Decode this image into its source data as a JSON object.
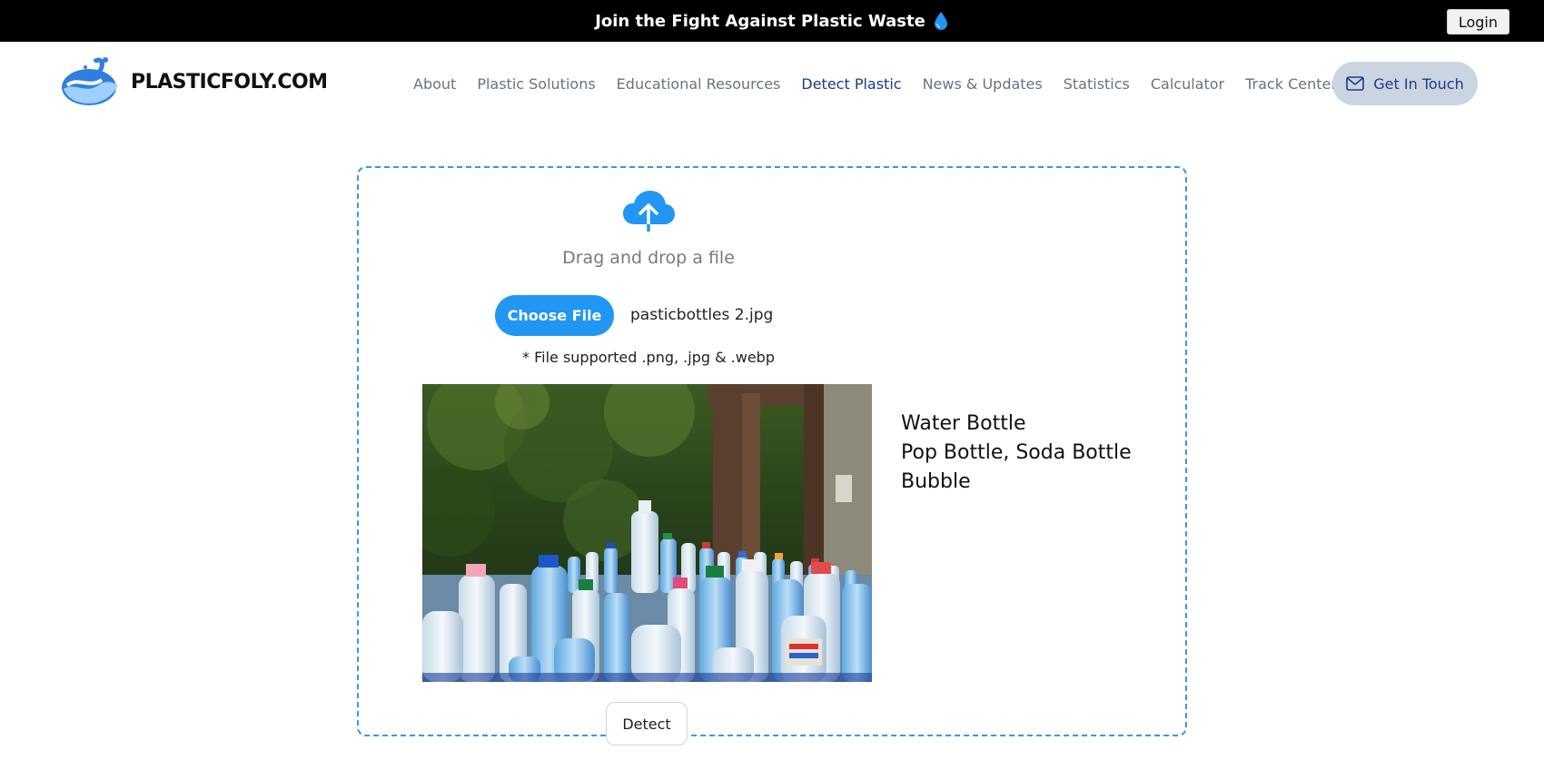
{
  "topbar": {
    "message": "Join the Fight Against Plastic Waste",
    "icon": "water-drop-icon",
    "login_label": "Login"
  },
  "header": {
    "logo_text": "PLASTICFOLY.COM",
    "nav": [
      {
        "label": "About",
        "active": false
      },
      {
        "label": "Plastic Solutions",
        "active": false
      },
      {
        "label": "Educational Resources",
        "active": false
      },
      {
        "label": "Detect Plastic",
        "active": true
      },
      {
        "label": "News & Updates",
        "active": false
      },
      {
        "label": "Statistics",
        "active": false
      },
      {
        "label": "Calculator",
        "active": false
      },
      {
        "label": "Track Centers",
        "active": false
      }
    ],
    "contact_label": "Get In Touch",
    "contact_icon": "mail-icon"
  },
  "upload": {
    "icon": "cloud-upload-icon",
    "drag_text": "Drag and drop a file",
    "choose_label": "Choose File",
    "file_name": "pasticbottles 2.jpg",
    "supported_text": "* File supported .png, .jpg & .webp",
    "results": [
      "Water Bottle",
      "Pop Bottle, Soda Bottle",
      "Bubble"
    ],
    "detect_label": "Detect"
  },
  "colors": {
    "accent": "#2196f3",
    "nav_active": "#1f3a8a",
    "contact_bg": "#cbd5e1",
    "dashed_border": "#3b97dd"
  }
}
